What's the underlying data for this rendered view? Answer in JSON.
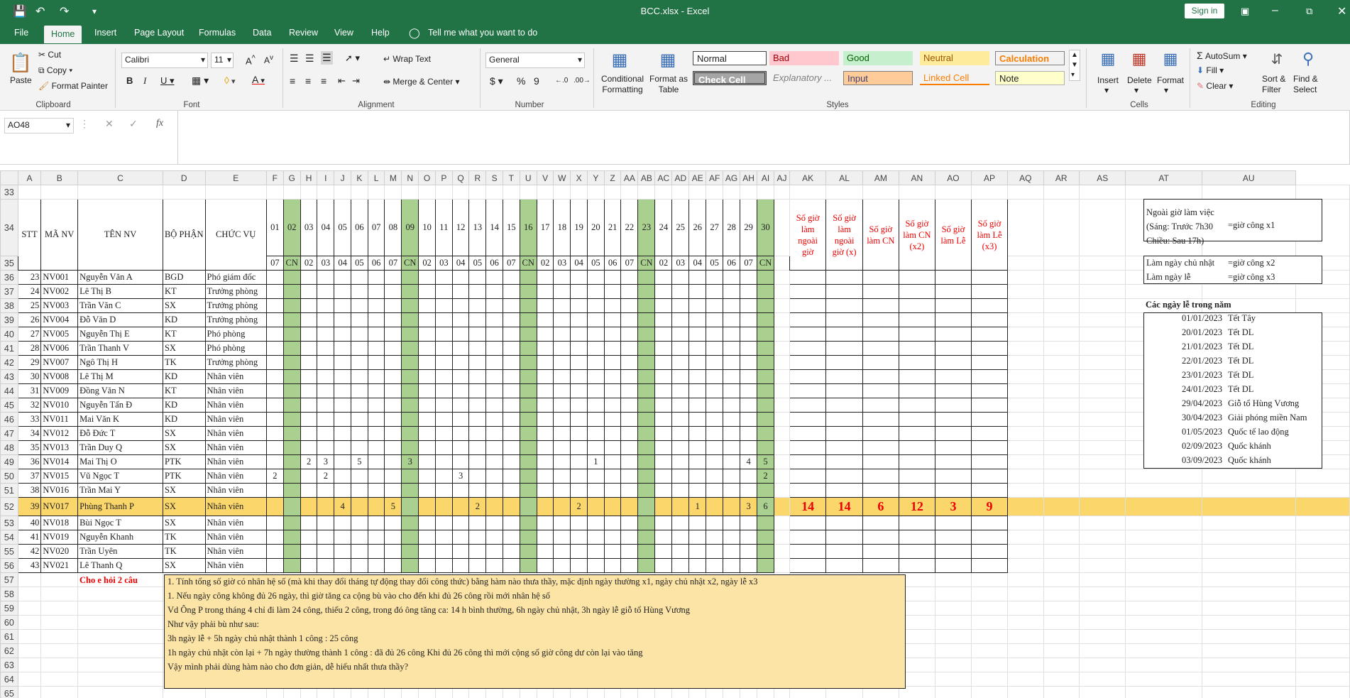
{
  "window": {
    "file_title": "BCC.xlsx - Excel",
    "sign_in": "Sign in"
  },
  "tabs": [
    "File",
    "Home",
    "Insert",
    "Page Layout",
    "Formulas",
    "Data",
    "Review",
    "View",
    "Help",
    "Tell me what you want to do"
  ],
  "ribbon": {
    "clipboard": {
      "paste": "Paste",
      "cut": "Cut",
      "copy": "Copy",
      "format_painter": "Format Painter",
      "group": "Clipboard"
    },
    "font": {
      "name": "Calibri",
      "size": "11",
      "group": "Font"
    },
    "alignment": {
      "wrap_text": "Wrap Text",
      "merge_center": "Merge & Center",
      "group": "Alignment"
    },
    "number": {
      "format": "General",
      "group": "Number"
    },
    "styles": {
      "conditional": "Conditional Formatting",
      "format_table": "Format as Table",
      "normal": "Normal",
      "bad": "Bad",
      "good": "Good",
      "neutral": "Neutral",
      "calculation": "Calculation",
      "check_cell": "Check Cell",
      "explanatory": "Explanatory ...",
      "input": "Input",
      "linked_cell": "Linked Cell",
      "note": "Note",
      "group": "Styles"
    },
    "cells": {
      "insert": "Insert",
      "delete": "Delete",
      "format": "Format",
      "group": "Cells"
    },
    "editing": {
      "autosum": "AutoSum",
      "fill": "Fill",
      "clear": "Clear",
      "sort": "Sort & Filter",
      "find": "Find & Select",
      "group": "Editing"
    }
  },
  "formula_bar": {
    "name_box": "AO48",
    "formula": ""
  },
  "columns": [
    "A",
    "B",
    "C",
    "D",
    "E",
    "F",
    "G",
    "H",
    "I",
    "J",
    "K",
    "L",
    "M",
    "N",
    "O",
    "P",
    "Q",
    "R",
    "S",
    "T",
    "U",
    "V",
    "W",
    "X",
    "Y",
    "Z",
    "AA",
    "AB",
    "AC",
    "AD",
    "AE",
    "AF",
    "AG",
    "AH",
    "AI",
    "AJ",
    "AK",
    "AL",
    "AM",
    "AN",
    "AO",
    "AP",
    "AQ",
    "AR",
    "AS",
    "AT",
    "AU"
  ],
  "header": {
    "stt": "STT",
    "ma_nv": "MÃ NV",
    "ten_nv": "TÊN NV",
    "bo_phan": "BỘ PHẬN",
    "chuc_vu": "CHỨC VỤ",
    "days": [
      "01",
      "02",
      "03",
      "04",
      "05",
      "06",
      "07",
      "08",
      "09",
      "10",
      "11",
      "12",
      "13",
      "14",
      "15",
      "16",
      "17",
      "18",
      "19",
      "20",
      "21",
      "22",
      "23",
      "24",
      "25",
      "26",
      "27",
      "28",
      "29",
      "30"
    ],
    "weekdays": [
      "07",
      "CN",
      "02",
      "03",
      "04",
      "05",
      "06",
      "07",
      "CN",
      "02",
      "03",
      "04",
      "05",
      "06",
      "07",
      "CN",
      "02",
      "03",
      "04",
      "05",
      "06",
      "07",
      "CN",
      "02",
      "03",
      "04",
      "05",
      "06",
      "07",
      "CN"
    ],
    "ak": "Số giờ làm ngoài giờ",
    "al": "Số giờ làm ngoài giờ (x)",
    "am": "Số giờ làm CN",
    "an": "Số giờ làm CN (x2)",
    "ao": "Số giờ làm Lễ",
    "ap": "Số giờ làm Lễ (x3)"
  },
  "employees": [
    {
      "row": "36",
      "stt": "23",
      "id": "NV001",
      "name": "Nguyễn Văn A",
      "dept": "BGD",
      "role": "Phó giám đốc"
    },
    {
      "row": "37",
      "stt": "24",
      "id": "NV002",
      "name": "Lê Thị B",
      "dept": "KT",
      "role": "Trưởng phòng"
    },
    {
      "row": "38",
      "stt": "25",
      "id": "NV003",
      "name": "Trần Văn C",
      "dept": "SX",
      "role": "Trưởng phòng"
    },
    {
      "row": "39",
      "stt": "26",
      "id": "NV004",
      "name": "Đỗ Văn D",
      "dept": "KD",
      "role": "Trưởng phòng"
    },
    {
      "row": "40",
      "stt": "27",
      "id": "NV005",
      "name": "Nguyễn Thị E",
      "dept": "KT",
      "role": "Phó phòng"
    },
    {
      "row": "41",
      "stt": "28",
      "id": "NV006",
      "name": "Trần Thanh V",
      "dept": "SX",
      "role": "Phó phòng"
    },
    {
      "row": "42",
      "stt": "29",
      "id": "NV007",
      "name": "Ngô Thị H",
      "dept": "TK",
      "role": "Trưởng phòng"
    },
    {
      "row": "43",
      "stt": "30",
      "id": "NV008",
      "name": "Lê Thị M",
      "dept": "KD",
      "role": "Nhân viên"
    },
    {
      "row": "44",
      "stt": "31",
      "id": "NV009",
      "name": "Đồng Văn N",
      "dept": "KT",
      "role": "Nhân viên"
    },
    {
      "row": "45",
      "stt": "32",
      "id": "NV010",
      "name": "Nguyễn Tấn Đ",
      "dept": "KD",
      "role": "Nhân viên"
    },
    {
      "row": "46",
      "stt": "33",
      "id": "NV011",
      "name": "Mai Văn K",
      "dept": "KD",
      "role": "Nhân viên"
    },
    {
      "row": "47",
      "stt": "34",
      "id": "NV012",
      "name": "Đỗ Đức T",
      "dept": "SX",
      "role": "Nhân viên"
    },
    {
      "row": "48",
      "stt": "35",
      "id": "NV013",
      "name": "Trần Duy Q",
      "dept": "SX",
      "role": "Nhân viên"
    },
    {
      "row": "49",
      "stt": "36",
      "id": "NV014",
      "name": "Mai Thị O",
      "dept": "PTK",
      "role": "Nhân viên",
      "hours": {
        "3": "2",
        "4": "3",
        "6": "5",
        "9": "3",
        "20": "1",
        "29": "4",
        "30": "5"
      }
    },
    {
      "row": "50",
      "stt": "37",
      "id": "NV015",
      "name": "Vũ Ngọc T",
      "dept": "PTK",
      "role": "Nhân viên",
      "hours": {
        "1": "2",
        "4": "2",
        "12": "3",
        "30": "2"
      }
    },
    {
      "row": "51",
      "stt": "38",
      "id": "NV016",
      "name": "Trần Mai Y",
      "dept": "SX",
      "role": "Nhân viên"
    },
    {
      "row": "52",
      "stt": "39",
      "id": "NV017",
      "name": "Phùng Thanh P",
      "dept": "SX",
      "role": "Nhân viên",
      "highlight": true,
      "hours": {
        "5": "4",
        "8": "5",
        "13": "2",
        "19": "2",
        "26": "1",
        "29": "3",
        "30": "6"
      },
      "totals": [
        "14",
        "14",
        "6",
        "12",
        "3",
        "9"
      ]
    },
    {
      "row": "53",
      "stt": "40",
      "id": "NV018",
      "name": "Bùi Ngọc T",
      "dept": "SX",
      "role": "Nhân viên"
    },
    {
      "row": "54",
      "stt": "41",
      "id": "NV019",
      "name": "Nguyễn Khanh",
      "dept": "TK",
      "role": "Nhân viên"
    },
    {
      "row": "55",
      "stt": "42",
      "id": "NV020",
      "name": "Trần Uyên",
      "dept": "TK",
      "role": "Nhân viên"
    },
    {
      "row": "56",
      "stt": "43",
      "id": "NV021",
      "name": "Lê Thanh Q",
      "dept": "SX",
      "role": "Nhân viên"
    }
  ],
  "legend": {
    "line1": "Ngoài giờ làm việc",
    "line2": "(Sáng: Trước 7h30",
    "line3": "Chiều: Sau 17h)",
    "val1": "=giờ công x1",
    "sunday": "Làm ngày chủ nhật",
    "val2": "=giờ công x2",
    "holiday": "Làm ngày lễ",
    "val3": "=giờ công x3"
  },
  "holidays_title": "Các ngày lễ trong năm",
  "holidays": [
    {
      "date": "01/01/2023",
      "name": "Tết Tây"
    },
    {
      "date": "20/01/2023",
      "name": "Tết DL"
    },
    {
      "date": "21/01/2023",
      "name": "Tết DL"
    },
    {
      "date": "22/01/2023",
      "name": "Tết DL"
    },
    {
      "date": "23/01/2023",
      "name": "Tết DL"
    },
    {
      "date": "24/01/2023",
      "name": "Tết DL"
    },
    {
      "date": "29/04/2023",
      "name": "Giỗ tổ Hùng Vương"
    },
    {
      "date": "30/04/2023",
      "name": "Giải phóng miền Nam"
    },
    {
      "date": "01/05/2023",
      "name": "Quốc tế lao động"
    },
    {
      "date": "02/09/2023",
      "name": "Quốc khánh"
    },
    {
      "date": "03/09/2023",
      "name": "Quốc khánh"
    }
  ],
  "question_label": "Cho e hỏi 2 câu",
  "note_lines": [
    "1. Tính tổng số giờ có nhân hệ số (mà khi thay đổi tháng tự động thay đổi công thức) bằng hàm nào thưa thầy, mặc định ngày thường x1, ngày chủ nhật x2, ngày lễ x3",
    "1. Nếu ngày công không đủ 26 ngày, thì giờ tăng ca cộng bù vào cho đến khi đủ 26 công rồi mới nhân hệ số",
    "Vd          Ông P trong tháng 4 chỉ đi làm 24 công, thiếu 2 công, trong đó ông tăng ca: 14 h bình thường,  6h ngày chủ nhật, 3h ngày lễ giỗ tổ Hùng Vương",
    "                Như vậy phải bù như sau:",
    "                3h ngày lễ + 5h ngày chủ nhật thành 1 công                          : 25 công",
    "                1h ngày chủ nhật còn lại + 7h ngày thường thành 1 công                : đã đủ 26 công            Khi đủ 26 công thì mới cộng số giờ công dư còn lại vào tăng",
    "                Vậy mình phải dùng hàm nào cho đơn giản, dễ hiểu nhất thưa thầy?"
  ],
  "rows": {
    "r33": "33",
    "r34": "34",
    "r35": "35",
    "r57": "57",
    "r58": "58",
    "r59": "59",
    "r60": "60",
    "r61": "61",
    "r62": "62",
    "r63": "63",
    "r64": "64",
    "r65": "65"
  }
}
